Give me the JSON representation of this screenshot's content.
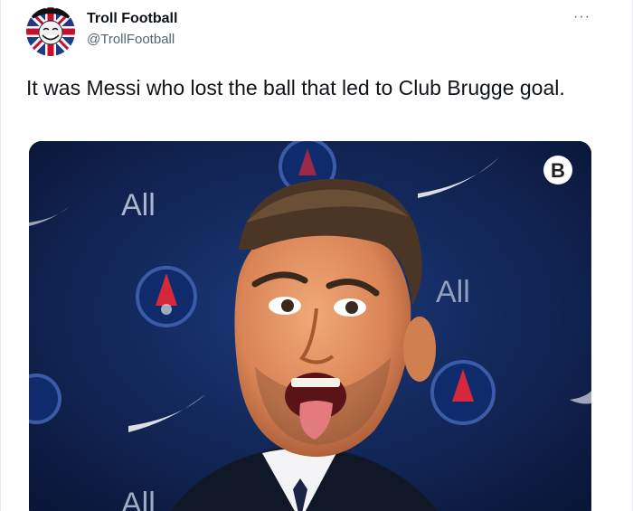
{
  "account": {
    "name": "Troll Football",
    "handle": "@TrollFootball",
    "avatar_icon": "troll-face-union-jack-logo"
  },
  "more_icon": "more-options-icon",
  "more_glyph": "···",
  "tweet": {
    "text": "It was Messi who lost the ball that led to Club Brugge goal."
  },
  "media": {
    "watermark_glyph": "B",
    "backdrop_text": [
      "All",
      "All",
      "All"
    ],
    "colors": {
      "backdrop": "#0c1b46",
      "crest_red": "#d6283b"
    }
  }
}
